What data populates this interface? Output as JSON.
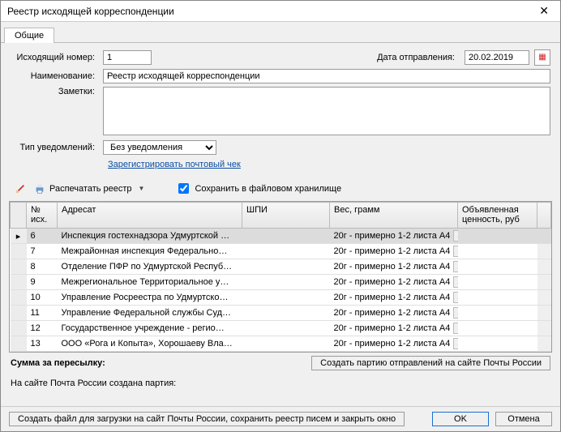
{
  "window": {
    "title": "Реестр исходящей корреспонденции"
  },
  "tabs": {
    "general": "Общие"
  },
  "form": {
    "outgoing_number_label": "Исходящий номер:",
    "outgoing_number_value": "1",
    "send_date_label": "Дата отправления:",
    "send_date_value": "20.02.2019",
    "name_label": "Наименование:",
    "name_value": "Реестр исходящей корреспонденции",
    "notes_label": "Заметки:",
    "notes_value": "",
    "notif_type_label": "Тип уведомлений:",
    "notif_type_value": "Без уведомления",
    "register_check_link": "Зарегистрировать почтовый чек"
  },
  "toolbar": {
    "print_label": "Распечатать реестр",
    "store_checkbox_label": "Сохранить в файловом хранилище",
    "store_checked": true
  },
  "grid": {
    "columns": {
      "num": "№ исх.",
      "addressee": "Адресат",
      "shpi": "ШПИ",
      "weight": "Вес, грамм",
      "declared_value": "Объявленная ценность, руб"
    },
    "rows": [
      {
        "num": "6",
        "addressee": "Инспекция гостехнадзора Удмуртской …",
        "shpi": "",
        "weight": "20г - примерно 1-2 листа A4",
        "declared_value": "",
        "selected": true
      },
      {
        "num": "7",
        "addressee": "Межрайонная инспекция Федерально…",
        "shpi": "",
        "weight": "20г - примерно 1-2 листа A4",
        "declared_value": "",
        "selected": false
      },
      {
        "num": "8",
        "addressee": "Отделение ПФР по Удмуртской Респуб…",
        "shpi": "",
        "weight": "20г - примерно 1-2 листа A4",
        "declared_value": "",
        "selected": false
      },
      {
        "num": "9",
        "addressee": "Межрегиональное Территориальное у…",
        "shpi": "",
        "weight": "20г - примерно 1-2 листа A4",
        "declared_value": "",
        "selected": false
      },
      {
        "num": "10",
        "addressee": "Управление Росреестра по Удмуртско…",
        "shpi": "",
        "weight": "20г - примерно 1-2 листа A4",
        "declared_value": "",
        "selected": false
      },
      {
        "num": "11",
        "addressee": "Управление Федеральной службы Суд…",
        "shpi": "",
        "weight": "20г - примерно 1-2 листа A4",
        "declared_value": "",
        "selected": false
      },
      {
        "num": "12",
        "addressee": "Государственное учреждение - регио…",
        "shpi": "",
        "weight": "20г - примерно 1-2 листа A4",
        "declared_value": "",
        "selected": false
      },
      {
        "num": "13",
        "addressee": "ООО «Рога и Копыта», Хорошаеву Вла…",
        "shpi": "",
        "weight": "20г - примерно 1-2 листа A4",
        "declared_value": "",
        "selected": false
      }
    ]
  },
  "footer": {
    "sum_label": "Сумма за пересылку:",
    "create_batch_button": "Создать партию отправлений на сайте Почты России",
    "site_info": "На сайте Почта России создана партия:",
    "create_file_button": "Создать файл для загрузки на сайт Почты России, сохранить реестр писем и закрыть окно",
    "ok": "OK",
    "cancel": "Отмена"
  }
}
